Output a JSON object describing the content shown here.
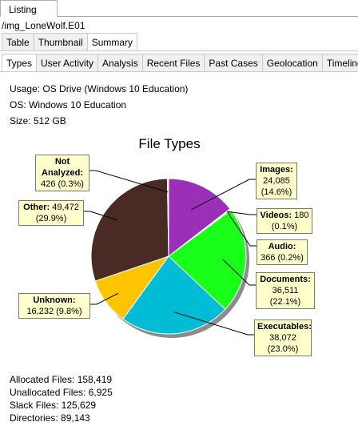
{
  "tabs_top": {
    "listing": "Listing"
  },
  "path": "/img_LoneWolf.E01",
  "view_tabs": [
    "Table",
    "Thumbnail",
    "Summary"
  ],
  "sub_tabs": [
    "Types",
    "User Activity",
    "Analysis",
    "Recent Files",
    "Past Cases",
    "Geolocation",
    "Timeline"
  ],
  "info": {
    "usage": "Usage: OS Drive (Windows 10 Education)",
    "os": "OS: Windows 10 Education",
    "size": "Size: 512 GB"
  },
  "colors": {
    "images": "#9b2fb8",
    "videos": "#e6e6e6",
    "audio": "#ffffff",
    "documents": "#1aff1a",
    "executables": "#00bcd4",
    "unknown": "#ffc400",
    "other": "#4a2a25",
    "not_analyzed": "#bdbdbd"
  },
  "chart_data": {
    "type": "pie",
    "title": "File Types",
    "slices": [
      {
        "label": "Images",
        "value": 24085,
        "percent": "14.6%",
        "color": "#9b2fb8"
      },
      {
        "label": "Videos",
        "value": 180,
        "percent": "0.1%",
        "color": "#9b2fb8"
      },
      {
        "label": "Audio",
        "value": 366,
        "percent": "0.2%",
        "color": "#1aff1a"
      },
      {
        "label": "Documents",
        "value": 36511,
        "percent": "22.1%",
        "color": "#1aff1a"
      },
      {
        "label": "Executables",
        "value": 38072,
        "percent": "23.0%",
        "color": "#00bcd4"
      },
      {
        "label": "Unknown",
        "value": 16232,
        "percent": "9.8%",
        "color": "#ffc400"
      },
      {
        "label": "Other",
        "value": 49472,
        "percent": "29.9%",
        "color": "#4a2a25"
      },
      {
        "label": "Not Analyzed",
        "value": 426,
        "percent": "0.3%",
        "color": "#ffffff"
      }
    ]
  },
  "callouts": {
    "not_analyzed": {
      "name": "Not Analyzed:",
      "value": "426 (0.3%)"
    },
    "other": {
      "name": "Other:",
      "value": "49,472 (29.9%)"
    },
    "images": {
      "name": "Images:",
      "value": "24,085 (14.6%)"
    },
    "videos": {
      "name": "Videos:",
      "value": "180 (0.1%)"
    },
    "audio": {
      "name": "Audio:",
      "value": "366 (0.2%)"
    },
    "documents": {
      "name": "Documents:",
      "value": "36,511 (22.1%)"
    },
    "executables": {
      "name": "Executables:",
      "value": "38,072 (23.0%)"
    },
    "unknown": {
      "name": "Unknown:",
      "value": "16,232 (9.8%)"
    }
  },
  "stats": {
    "allocated": "Allocated Files: 158,419",
    "unallocated": "Unallocated Files: 6,925",
    "slack": "Slack Files: 125,629",
    "directories": "Directories: 89,143"
  }
}
